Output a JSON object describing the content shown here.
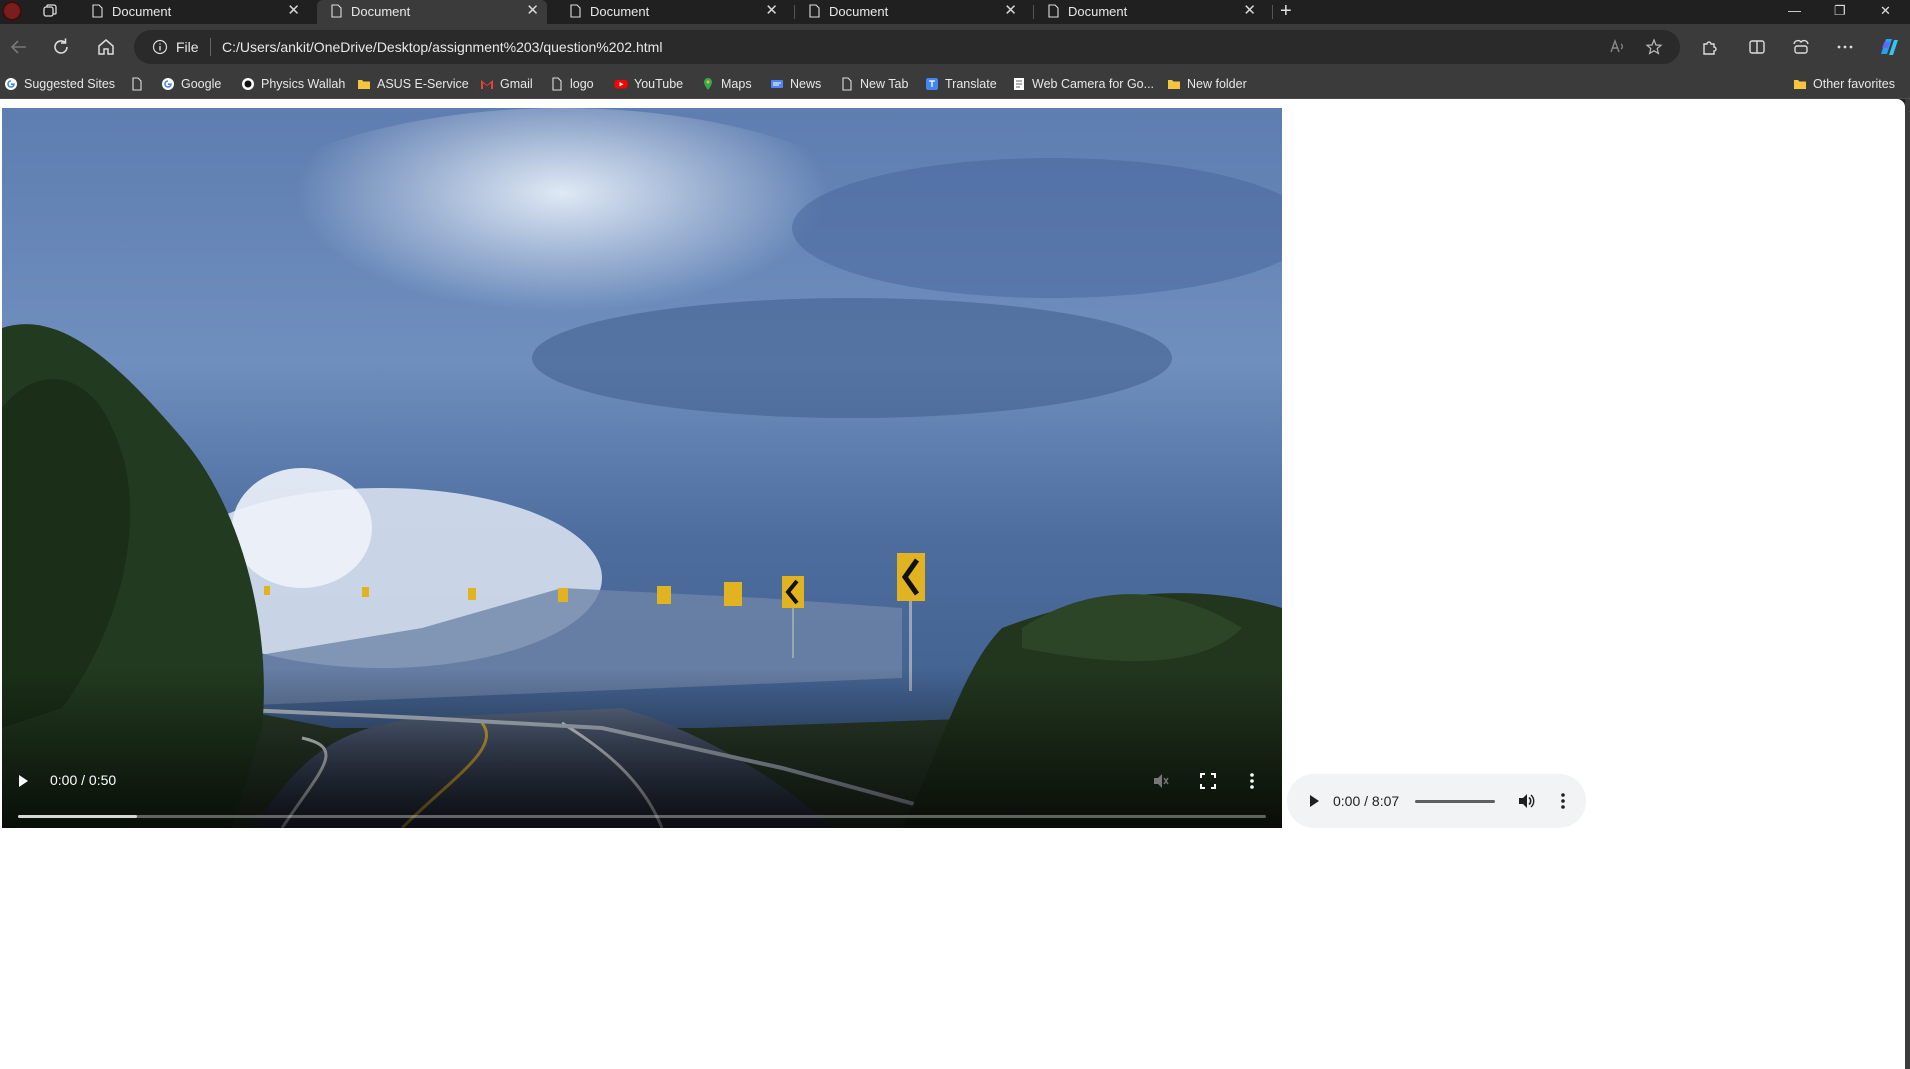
{
  "tabs": [
    {
      "title": "Document",
      "active": false
    },
    {
      "title": "Document",
      "active": true
    },
    {
      "title": "Document",
      "active": false
    },
    {
      "title": "Document",
      "active": false
    },
    {
      "title": "Document",
      "active": false
    }
  ],
  "tab_close_glyph": "✕",
  "new_tab_glyph": "+",
  "window_controls": {
    "minimize": "—",
    "restore": "❐",
    "close": "✕"
  },
  "address_bar": {
    "scheme_label": "File",
    "url": "C:/Users/ankit/OneDrive/Desktop/assignment%203/question%202.html"
  },
  "bookmarks": [
    {
      "label": "Suggested Sites",
      "icon": "google-icon"
    },
    {
      "label": "",
      "icon": "page-icon"
    },
    {
      "label": "Google",
      "icon": "google-icon"
    },
    {
      "label": "Physics Wallah",
      "icon": "physics-wallah-icon"
    },
    {
      "label": "ASUS E-Service",
      "icon": "folder-icon"
    },
    {
      "label": "Gmail",
      "icon": "gmail-icon"
    },
    {
      "label": "logo",
      "icon": "page-icon"
    },
    {
      "label": "YouTube",
      "icon": "youtube-icon"
    },
    {
      "label": "Maps",
      "icon": "maps-icon"
    },
    {
      "label": "News",
      "icon": "news-icon"
    },
    {
      "label": "New Tab",
      "icon": "page-icon"
    },
    {
      "label": "Translate",
      "icon": "translate-icon"
    },
    {
      "label": "Web Camera for Go...",
      "icon": "page-icon"
    },
    {
      "label": "New folder",
      "icon": "folder-icon"
    }
  ],
  "other_favorites": "Other favorites",
  "video": {
    "current_time": "0:00",
    "duration": "0:50",
    "time_display": "0:00 / 0:50",
    "buffered_fraction": 0.095
  },
  "audio": {
    "current_time": "0:00",
    "duration": "8:07",
    "time_display": "0:00 / 8:07"
  },
  "colors": {
    "chrome_dark": "#202020",
    "toolbar": "#3b3b3b",
    "page_bg": "#ffffff",
    "audio_bg": "#f1f3f4"
  }
}
